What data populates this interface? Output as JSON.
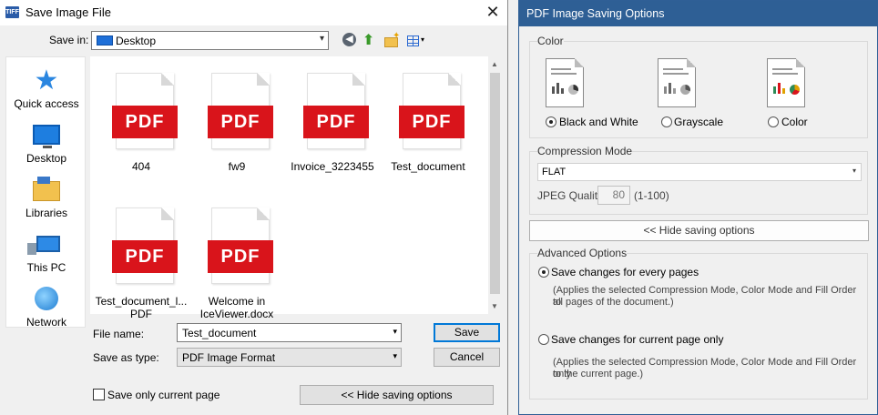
{
  "dialog": {
    "title": "Save Image File",
    "app_icon": "TIFF",
    "close": "✕",
    "save_in_label": "Save in:",
    "save_in_value": "Desktop",
    "toolbar": {
      "back": "◀",
      "up": "⬆",
      "new_folder": "✦",
      "view": "▾"
    },
    "places": [
      {
        "label": "Quick access",
        "icon": "★"
      },
      {
        "label": "Desktop"
      },
      {
        "label": "Libraries"
      },
      {
        "label": "This PC"
      },
      {
        "label": "Network"
      }
    ],
    "files": [
      {
        "name": "404",
        "badge": "PDF"
      },
      {
        "name": "fw9",
        "badge": "PDF"
      },
      {
        "name": "Invoice_3223455",
        "badge": "PDF"
      },
      {
        "name": "Test_document",
        "badge": "PDF"
      },
      {
        "name": "Test_document_l...",
        "name2": "PDF",
        "badge": "PDF"
      },
      {
        "name": "Welcome in",
        "name2": "IceViewer.docx",
        "badge": "PDF"
      }
    ],
    "scroll": {
      "up": "▲",
      "down": "▼"
    },
    "file_name_label": "File name:",
    "file_name_value": "Test_document",
    "save_as_type_label": "Save as type:",
    "save_as_type_value": "PDF Image Format",
    "dropdown_arrow": "▾",
    "save_button": "Save",
    "cancel_button": "Cancel",
    "only_current_label": "Save only current page",
    "hide_options_button": "<< Hide saving options"
  },
  "panel": {
    "title": "PDF Image Saving Options",
    "color": {
      "caption": "Color",
      "options": [
        "Black and White",
        "Grayscale",
        "Color"
      ],
      "selected": "Black and White"
    },
    "compression": {
      "caption": "Compression Mode",
      "mode": "FLAT",
      "arrow": "▾",
      "jpeg_label": "JPEG Quality",
      "jpeg_value": "80",
      "jpeg_range": "(1-100)"
    },
    "hide_button": "<< Hide saving options",
    "advanced": {
      "caption": "Advanced Options",
      "opt1": "Save changes for every pages",
      "opt1_note1": "(Applies the selected Compression Mode, Color Mode and Fill Order to",
      "opt1_note2": "all pages of the document.)",
      "opt2": "Save changes for current page only",
      "opt2_note1": "(Applies the selected Compression Mode, Color Mode and Fill Order only",
      "opt2_note2": "to the current page.)",
      "selected": "Save changes for every pages"
    }
  },
  "colors": {
    "panel_title_bg": "#2e5f95",
    "pdf_badge": "#d9141b",
    "accent": "#0078d7"
  }
}
